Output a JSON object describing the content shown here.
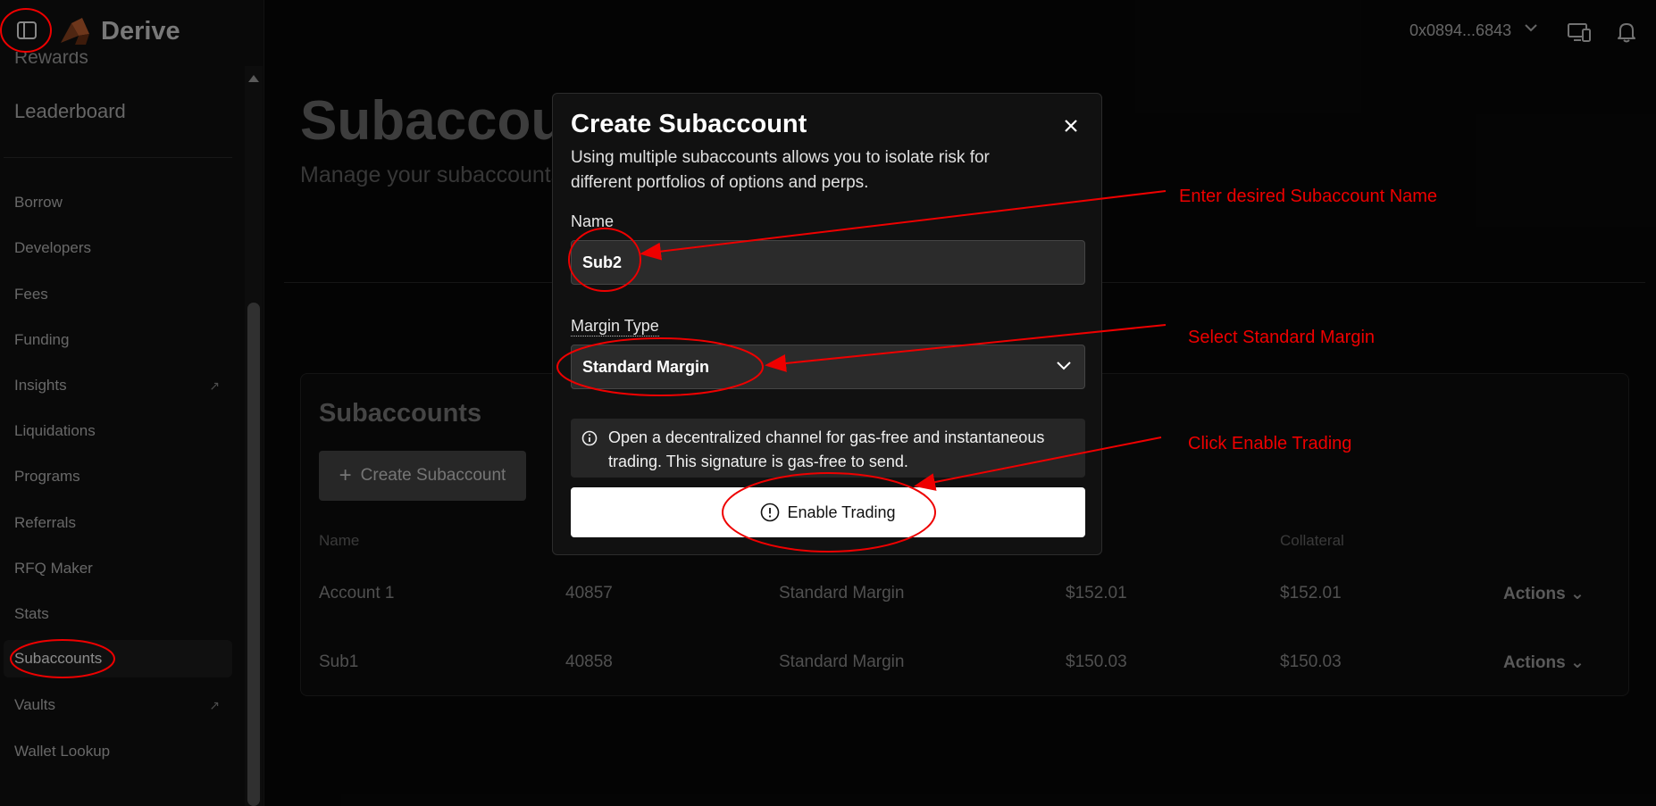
{
  "brand": {
    "name": "Derive"
  },
  "header": {
    "account": "0x0894...6843"
  },
  "sidebar": {
    "faded_item": "Rewards",
    "leaderboard": "Leaderboard",
    "items": [
      {
        "label": "Borrow"
      },
      {
        "label": "Developers"
      },
      {
        "label": "Fees"
      },
      {
        "label": "Funding"
      },
      {
        "label": "Insights"
      },
      {
        "label": "Liquidations"
      },
      {
        "label": "Programs"
      },
      {
        "label": "Referrals"
      },
      {
        "label": "RFQ Maker"
      },
      {
        "label": "Stats"
      },
      {
        "label": "Subaccounts"
      },
      {
        "label": "Vaults"
      },
      {
        "label": "Wallet Lookup"
      }
    ]
  },
  "page": {
    "title": "Subaccounts",
    "subtitle": "Manage your subaccounts"
  },
  "panel": {
    "title": "Subaccounts",
    "create_button": "Create Subaccount",
    "columns": [
      "Name",
      "Collateral"
    ],
    "rows": [
      {
        "name": "Account 1",
        "id": "40857",
        "margin": "Standard Margin",
        "value": "$152.01",
        "collateral": "$152.01",
        "actions": "Actions"
      },
      {
        "name": "Sub1",
        "id": "40858",
        "margin": "Standard Margin",
        "value": "$150.03",
        "collateral": "$150.03",
        "actions": "Actions"
      }
    ]
  },
  "modal": {
    "title": "Create Subaccount",
    "description": "Using multiple subaccounts allows you to isolate risk for different portfolios of options and perps.",
    "name_label": "Name",
    "name_value": "Sub2",
    "margin_label": "Margin Type",
    "margin_value": "Standard Margin",
    "info_text": "Open a decentralized channel for gas-free and instantaneous trading. This signature is gas-free to send.",
    "enable_button": "Enable Trading"
  },
  "annotations": {
    "name": "Enter desired Subaccount Name",
    "margin": "Select Standard Margin",
    "enable": "Click Enable Trading",
    "color": "#ee0000"
  }
}
